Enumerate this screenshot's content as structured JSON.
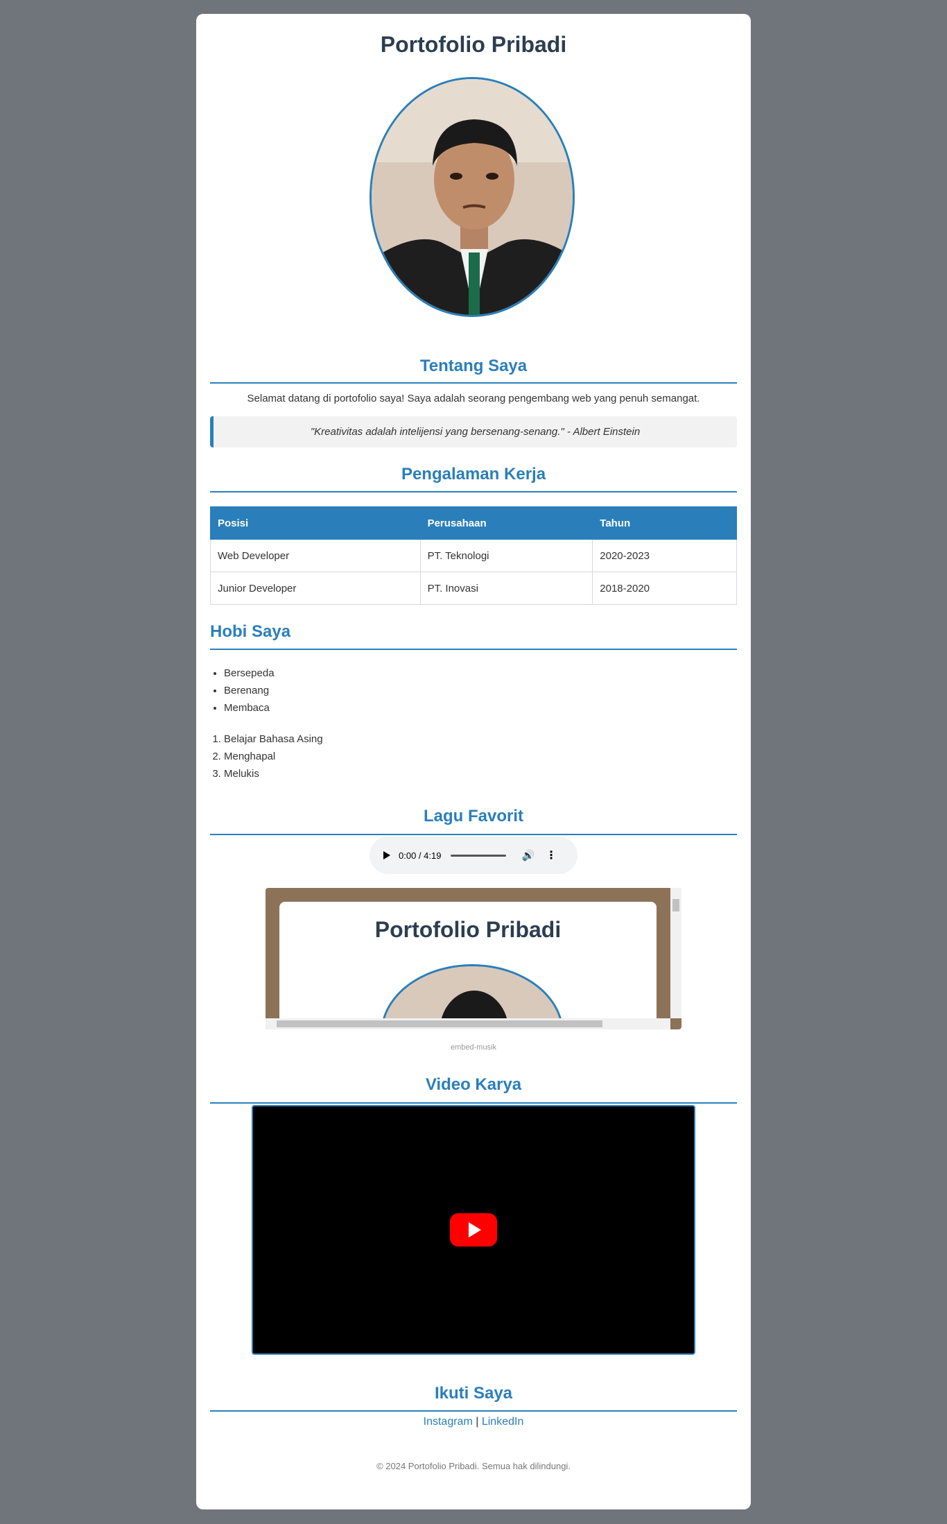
{
  "header": {
    "title": "Portofolio Pribadi"
  },
  "about": {
    "title": "Tentang Saya",
    "intro": "Selamat datang di portofolio saya! Saya adalah seorang pengembang web yang penuh semangat.",
    "quote": "\"Kreativitas adalah intelijensi yang bersenang-senang.\" - Albert Einstein"
  },
  "experience": {
    "title": "Pengalaman Kerja",
    "headers": [
      "Posisi",
      "Perusahaan",
      "Tahun"
    ],
    "rows": [
      [
        "Web Developer",
        "PT. Teknologi",
        "2020-2023"
      ],
      [
        "Junior Developer",
        "PT. Inovasi",
        "2018-2020"
      ]
    ]
  },
  "hobbies": {
    "title": "Hobi Saya",
    "unordered": [
      "Bersepeda",
      "Berenang",
      "Membaca"
    ],
    "ordered": [
      "Belajar Bahasa Asing",
      "Menghapal",
      "Melukis"
    ]
  },
  "music": {
    "title": "Lagu Favorit",
    "audio_time": "0:00 / 4:19",
    "embed_title": "Portofolio Pribadi",
    "caption": "embed-musik"
  },
  "video": {
    "title": "Video Karya"
  },
  "social": {
    "title": "Ikuti Saya",
    "instagram": "Instagram",
    "separator": "|",
    "linkedin": "LinkedIn"
  },
  "footer": {
    "text": "© 2024 Portofolio Pribadi. Semua hak dilindungi."
  },
  "colors": {
    "accent": "#2a7fba",
    "title": "#2c3e50",
    "background": "#70747b"
  }
}
